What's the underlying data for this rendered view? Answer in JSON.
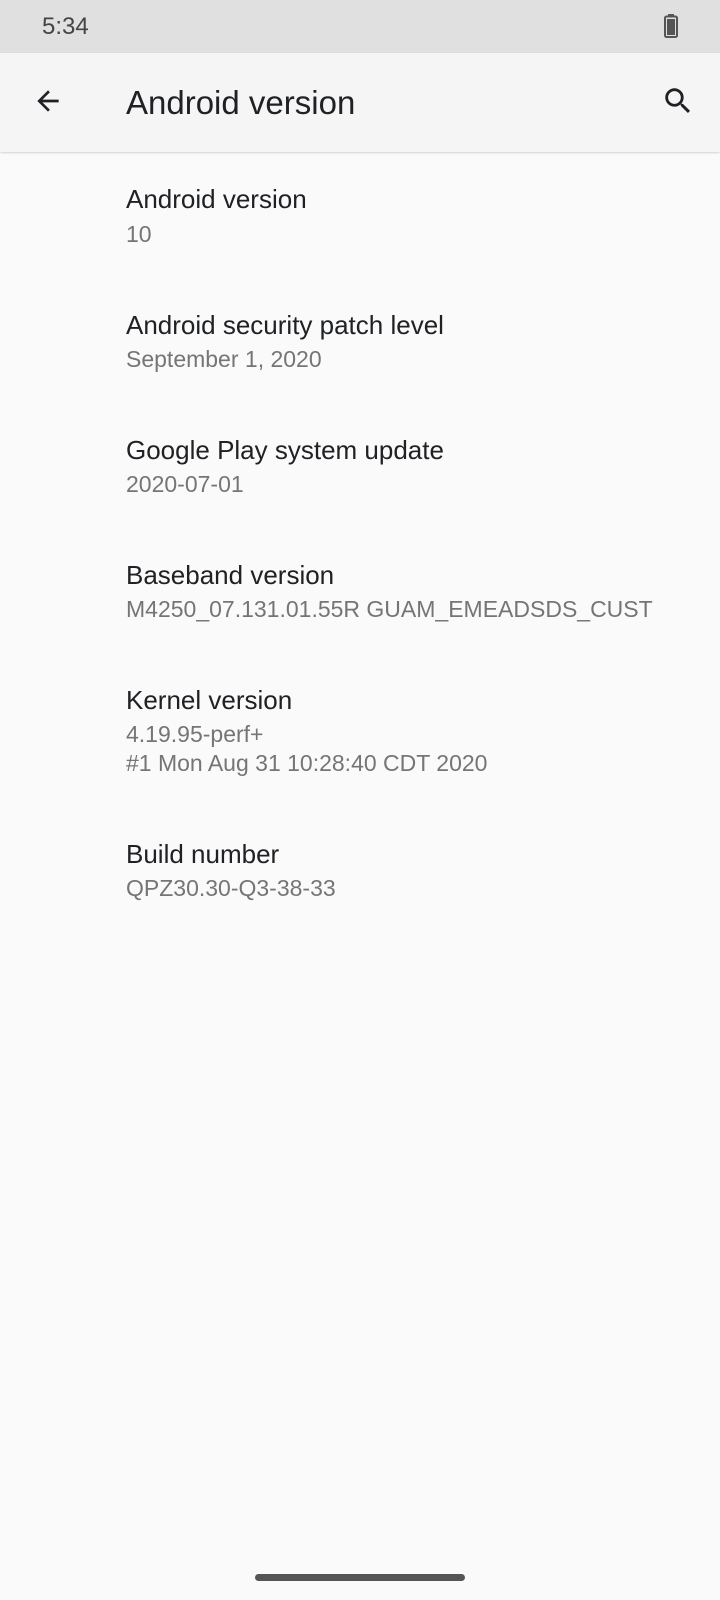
{
  "status_bar": {
    "time": "5:34",
    "battery_icon": "battery-icon"
  },
  "app_bar": {
    "back_icon": "arrow-back-icon",
    "title": "Android version",
    "search_icon": "search-icon"
  },
  "items": [
    {
      "title": "Android version",
      "summary": "10"
    },
    {
      "title": "Android security patch level",
      "summary": "September 1, 2020"
    },
    {
      "title": "Google Play system update",
      "summary": "2020-07-01"
    },
    {
      "title": "Baseband version",
      "summary": "M4250_07.131.01.55R GUAM_EMEADSDS_CUST"
    },
    {
      "title": "Kernel version",
      "summary_line1": "4.19.95-perf+",
      "summary_line2": "#1 Mon Aug 31 10:28:40 CDT 2020"
    },
    {
      "title": "Build number",
      "summary": "QPZ30.30-Q3-38-33"
    }
  ],
  "colors": {
    "status_bar_bg": "#e0e0e0",
    "app_bar_bg": "#f5f5f5",
    "background": "#fafafa",
    "primary_text": "#202124",
    "secondary_text": "#757575"
  }
}
